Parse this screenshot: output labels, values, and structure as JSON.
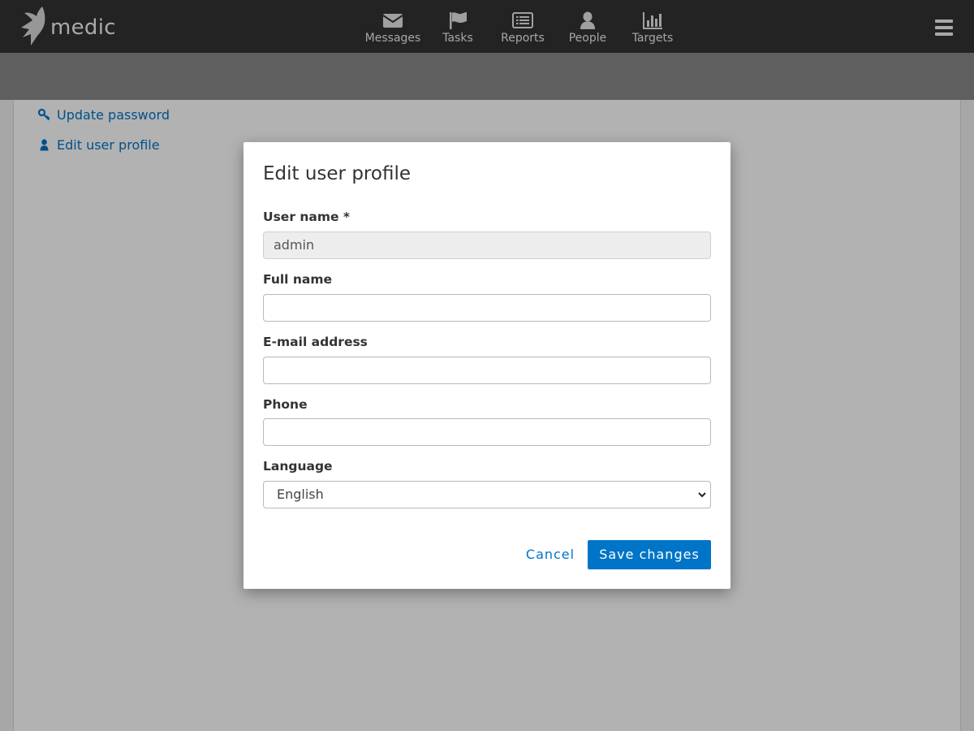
{
  "app": {
    "logo_text": "medic"
  },
  "nav": {
    "tabs": [
      {
        "label": "Messages",
        "icon": "envelope-icon"
      },
      {
        "label": "Tasks",
        "icon": "flag-icon"
      },
      {
        "label": "Reports",
        "icon": "list-icon"
      },
      {
        "label": "People",
        "icon": "user-icon"
      },
      {
        "label": "Targets",
        "icon": "bar-chart-icon"
      }
    ],
    "menu_icon": "hamburger-icon"
  },
  "sidebar": {
    "links": [
      {
        "label": "Update password",
        "icon": "key-icon"
      },
      {
        "label": "Edit user profile",
        "icon": "user-icon"
      }
    ]
  },
  "modal": {
    "title": "Edit user profile",
    "fields": {
      "username": {
        "label": "User name *",
        "value": "admin"
      },
      "fullname": {
        "label": "Full name",
        "value": ""
      },
      "email": {
        "label": "E-mail address",
        "value": ""
      },
      "phone": {
        "label": "Phone",
        "value": ""
      },
      "language": {
        "label": "Language",
        "value": "English"
      }
    },
    "cancel_label": "Cancel",
    "save_label": "Save changes"
  },
  "colors": {
    "navbar": "#333333",
    "accent": "#0074c7",
    "overlay": "rgba(0,0,0,0.3)"
  }
}
